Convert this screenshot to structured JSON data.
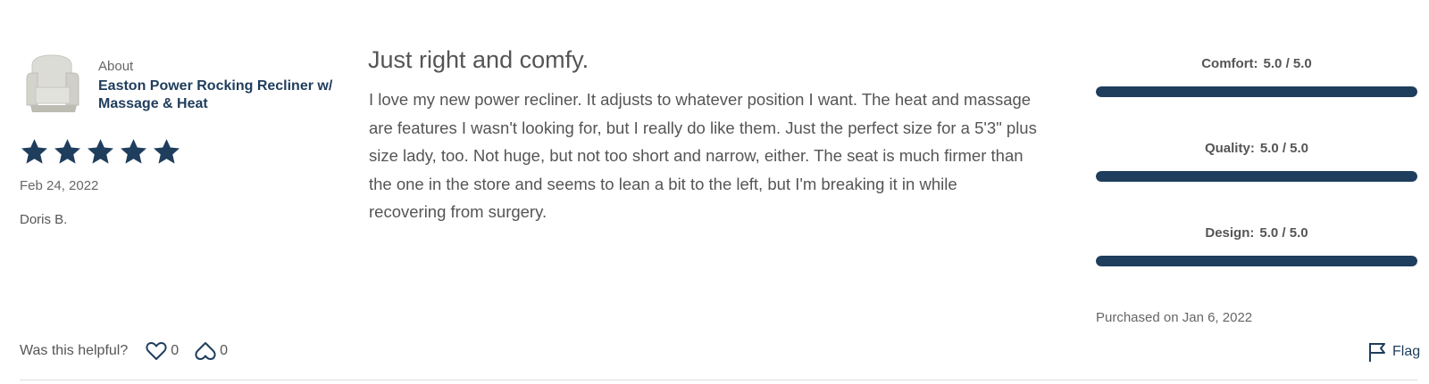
{
  "product": {
    "about_label": "About",
    "name": "Easton Power Rocking Recliner w/ Massage & Heat",
    "thumbnail_icon": "recliner-chair-image"
  },
  "review": {
    "rating": 5,
    "max_rating": 5,
    "date": "Feb 24, 2022",
    "author": "Doris B.",
    "title": "Just right and comfy.",
    "body": "I love my new power recliner. It adjusts to whatever position I want. The heat and massage are features I wasn't looking for, but I really do like them. Just the perfect size for a 5'3\" plus size lady, too. Not huge, but not too short and narrow, either. The seat is much firmer than the one in the store and seems to lean a bit to the left, but I'm breaking it in while recovering from surgery."
  },
  "ratings": [
    {
      "label": "Comfort:",
      "value_text": "5.0 / 5.0",
      "fraction": 1.0
    },
    {
      "label": "Quality:",
      "value_text": "5.0 / 5.0",
      "fraction": 1.0
    },
    {
      "label": "Design:",
      "value_text": "5.0 / 5.0",
      "fraction": 1.0
    }
  ],
  "purchased": "Purchased on Jan 6, 2022",
  "helpful": {
    "prompt": "Was this helpful?",
    "up_count": "0",
    "down_count": "0",
    "up_icon": "heart-icon",
    "down_icon": "heart-outline-down-icon"
  },
  "flag_label": "Flag",
  "colors": {
    "accent": "#1f3d5c",
    "star": "#1f3d5c",
    "text": "#555555"
  }
}
